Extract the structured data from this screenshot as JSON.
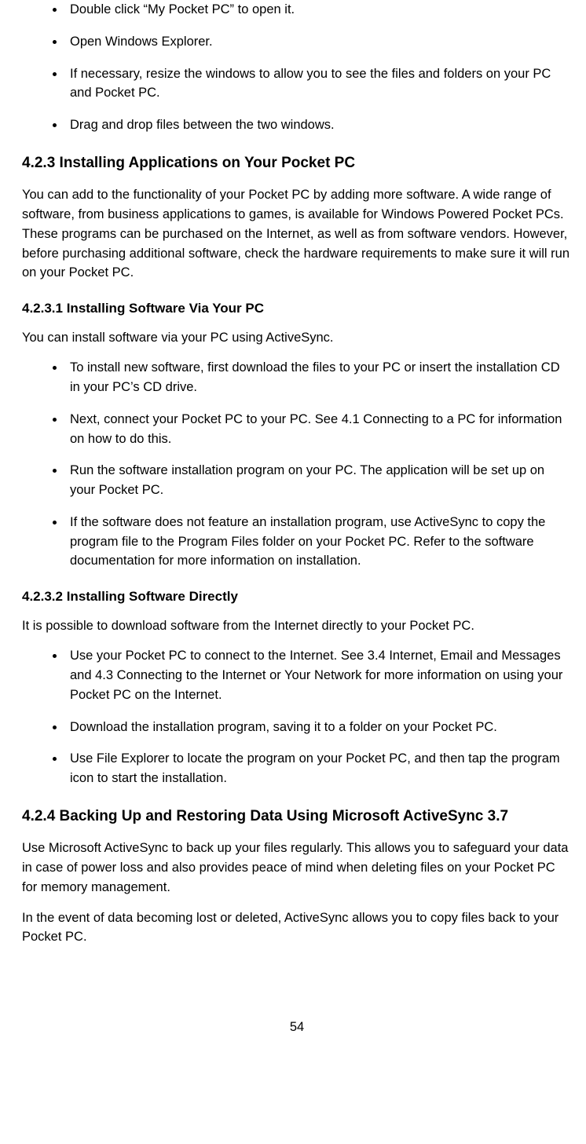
{
  "list1": [
    "Double click “My Pocket PC” to open it.",
    "Open Windows Explorer.",
    "If necessary, resize the windows to allow you to see the files and folders on your PC and Pocket PC.",
    "Drag and drop files between the two windows."
  ],
  "h1": "4.2.3 Installing Applications on Your Pocket PC",
  "p1": "You can add to the functionality of your Pocket PC by adding more software. A wide range of software, from business applications to games, is available for Windows Powered Pocket PCs. These programs can be purchased on the Internet, as well as from software vendors. However, before purchasing additional software, check the hardware requirements to make sure it will run on your Pocket PC.",
  "h2": "4.2.3.1 Installing Software Via Your PC",
  "p2": "You can install software via your PC using ActiveSync.",
  "list2": [
    "To install new software, first download the files to your PC or insert the installation CD in your PC’s CD drive.",
    "Next, connect your Pocket PC to your PC. See 4.1 Connecting to a PC for information on how to do this.",
    "Run the software installation program on your PC. The application will be set up on your Pocket PC.",
    "If the software does not feature an installation program, use ActiveSync to copy the program file to the Program Files folder on your Pocket PC. Refer to the software documentation for more information on installation."
  ],
  "h3": "4.2.3.2 Installing Software Directly",
  "p3": "It is possible to download software from the Internet directly to your Pocket PC.",
  "list3": [
    "Use your Pocket PC to connect to the Internet. See 3.4 Internet, Email and Messages and 4.3 Connecting to the Internet or Your Network for more information on using your Pocket PC on the Internet.",
    "Download the installation program, saving it to a folder on your Pocket PC.",
    "Use File Explorer to locate the program on your Pocket PC, and then tap the program icon to start the installation."
  ],
  "h4": "4.2.4 Backing Up and Restoring Data Using Microsoft ActiveSync 3.7",
  "p4": "Use Microsoft ActiveSync to back up your files regularly. This allows you to safeguard your data in case of power loss and also provides peace of mind when deleting files on your Pocket PC for memory management.",
  "p5": "In the event of data becoming lost or deleted, ActiveSync allows you to copy files back to your Pocket PC.",
  "pageNumber": "54"
}
